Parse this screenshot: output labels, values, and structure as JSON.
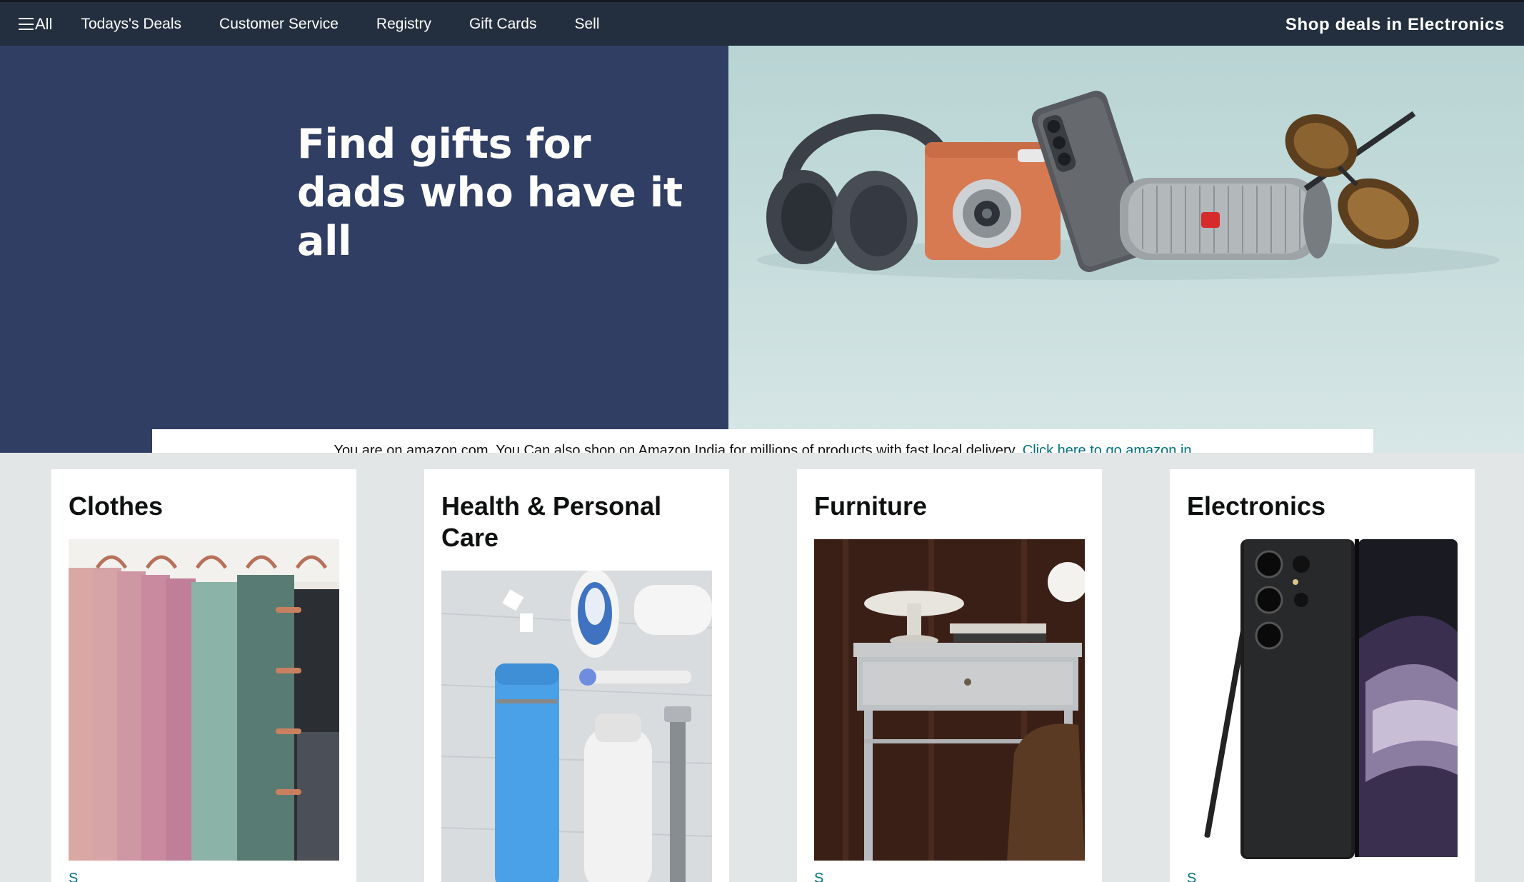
{
  "nav": {
    "all_label": "All",
    "links": [
      "Todays's Deals",
      "Customer Service",
      "Registry",
      "Gift Cards",
      "Sell"
    ],
    "promo": "Shop deals in Electronics"
  },
  "hero": {
    "title_line1": "Find gifts for",
    "title_line2": "dads who have it all"
  },
  "notice": {
    "text": "You are on amazon.com. You Can also shop on Amazon India for millions of products with fast local delivery.",
    "link": "Click here to go amazon.in"
  },
  "cards": [
    {
      "title": "Clothes",
      "link": "S"
    },
    {
      "title": "Health & Personal Care",
      "link": ""
    },
    {
      "title": "Furniture",
      "link": "S"
    },
    {
      "title": "Electronics",
      "link": "S"
    }
  ],
  "colors": {
    "nav_bg": "#232f3e",
    "hero_left_bg": "#303e64",
    "link": "#007185",
    "page_bg": "#e3e6e6"
  }
}
